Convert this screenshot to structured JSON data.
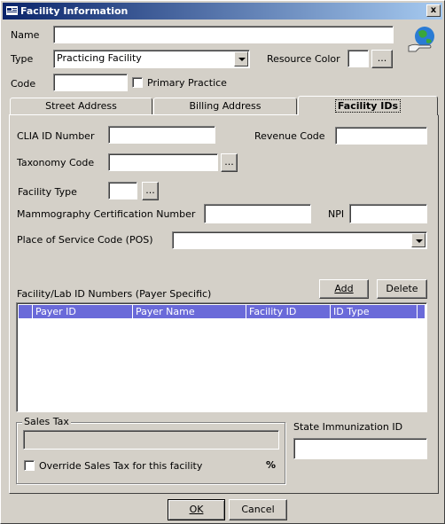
{
  "window": {
    "title": "Facility Information",
    "close_label": "x"
  },
  "fields": {
    "name_label": "Name",
    "name_value": "",
    "type_label": "Type",
    "type_value": "Practicing Facility",
    "resource_color_label": "Resource Color",
    "resource_color_button": "...",
    "code_label": "Code",
    "code_value": "",
    "primary_practice_label": "Primary Practice",
    "primary_practice_checked": false
  },
  "tabs": [
    {
      "label": "Street Address"
    },
    {
      "label": "Billing Address"
    },
    {
      "label": "Facility IDs"
    }
  ],
  "facility_ids": {
    "clia_label": "CLIA ID Number",
    "revenue_label": "Revenue Code",
    "taxonomy_label": "Taxonomy Code",
    "taxonomy_button": "...",
    "facility_type_label": "Facility Type",
    "facility_type_button": "...",
    "mammo_label": "Mammography Certification Number",
    "npi_label": "NPI",
    "pos_label": "Place of Service Code (POS)",
    "lab_ids_label": "Facility/Lab ID Numbers  (Payer Specific)",
    "add_button": "Add",
    "delete_button": "Delete",
    "grid_columns": [
      "Payer ID",
      "Payer Name",
      "Facility ID",
      "ID Type"
    ],
    "grid_rows": []
  },
  "sales_tax": {
    "group_label": "Sales Tax",
    "override_label": "Override Sales Tax for this facility",
    "percent_symbol": "%"
  },
  "state_immunization_label": "State Immunization ID",
  "footer": {
    "ok_label": "OK",
    "cancel_label": "Cancel"
  },
  "colors": {
    "title_start": "#0a246a",
    "title_end": "#a6caf0",
    "grid_header": "#6a6ad9",
    "face": "#d4d0c8"
  },
  "icons": [
    "app-icon",
    "globe-hand-icon",
    "dropdown-arrow-icon",
    "close-icon"
  ]
}
